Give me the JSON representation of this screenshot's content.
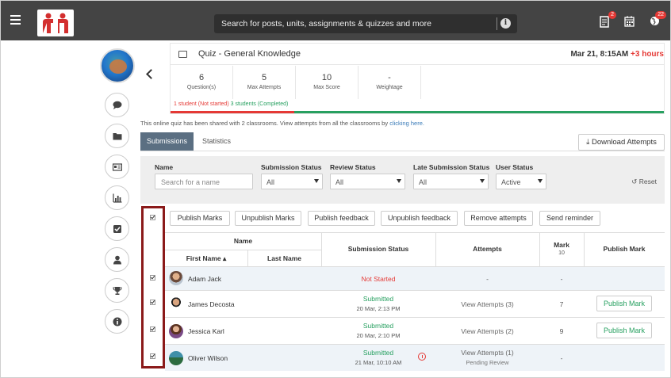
{
  "topbar": {
    "search_placeholder": "Search for posts, units, assignments & quizzes and more",
    "notifications_count": "2",
    "alerts_count": "22",
    "brand_color": "#444444"
  },
  "quiz": {
    "title": "Quiz - General Knowledge",
    "due_date": "Mar 21, 8:15AM",
    "late_text": "+3 hours",
    "stats": [
      {
        "value": "6",
        "label": "Question(s)"
      },
      {
        "value": "5",
        "label": "Max Attempts"
      },
      {
        "value": "10",
        "label": "Max Score"
      },
      {
        "value": "-",
        "label": "Weightage"
      }
    ],
    "not_started_text": "1 student (Not started)",
    "completed_text": "3 students (Completed)",
    "progress": {
      "not_started": 0.25,
      "completed": 0.75
    }
  },
  "shared_note": "This online quiz has been shared with 2 classrooms. View attempts from all the classrooms by",
  "shared_link": "clicking here.",
  "tabs": {
    "submissions": "Submissions",
    "statistics": "Statistics"
  },
  "download_label": "Download Attempts",
  "filters": {
    "name_label": "Name",
    "name_placeholder": "Search for a name",
    "submission_status_label": "Submission Status",
    "submission_status_value": "All",
    "review_status_label": "Review Status",
    "review_status_value": "All",
    "late_submission_label": "Late Submission Status",
    "late_submission_value": "All",
    "user_status_label": "User Status",
    "user_status_value": "Active",
    "reset_label": "Reset"
  },
  "actions": [
    "Publish Marks",
    "Unpublish Marks",
    "Publish feedback",
    "Unpublish feedback",
    "Remove attempts",
    "Send reminder"
  ],
  "table": {
    "headers": {
      "name": "Name",
      "first_name": "First Name",
      "last_name": "Last Name",
      "submission_status": "Submission Status",
      "attempts": "Attempts",
      "mark": "Mark",
      "mark_out_of": "10",
      "publish_mark": "Publish Mark"
    },
    "rows": [
      {
        "name": "Adam Jack",
        "status": "Not Started",
        "status_date": "",
        "attempts": "-",
        "attempts_note": "",
        "mark": "-",
        "publish": ""
      },
      {
        "name": "James Decosta",
        "status": "Submitted",
        "status_date": "20 Mar, 2:13 PM",
        "attempts": "View Attempts (3)",
        "attempts_note": "",
        "mark": "7",
        "publish": "Publish Mark"
      },
      {
        "name": "Jessica Karl",
        "status": "Submitted",
        "status_date": "20 Mar, 2:10 PM",
        "attempts": "View Attempts (2)",
        "attempts_note": "",
        "mark": "9",
        "publish": "Publish Mark"
      },
      {
        "name": "Oliver Wilson",
        "status": "Submitted",
        "status_date": "21 Mar, 10:10 AM",
        "attempts": "View Attempts (1)",
        "attempts_note": "Pending Review",
        "mark": "-",
        "publish": ""
      }
    ]
  },
  "colors": {
    "accent": "#27a060",
    "danger": "#e53935",
    "tab_active": "#5b6f82",
    "highlight_box": "#8b1a1a"
  }
}
